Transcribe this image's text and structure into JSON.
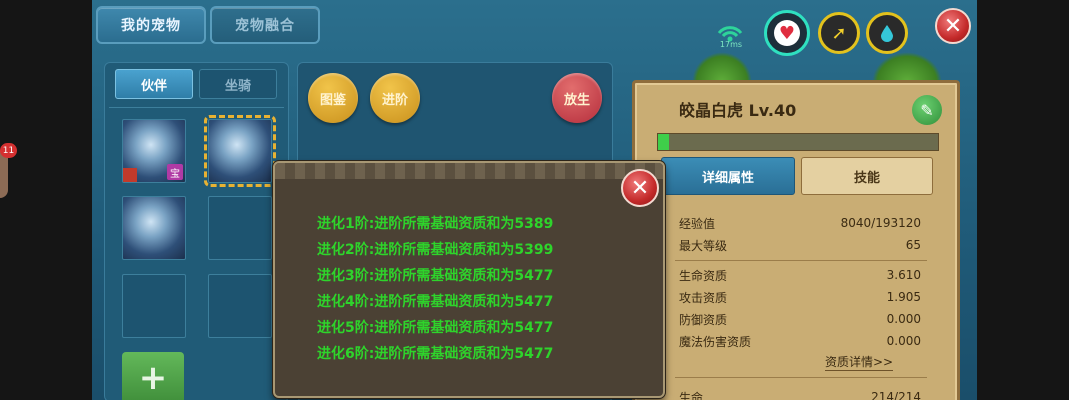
{
  "tabs": {
    "my_pets": "我的宠物",
    "pet_fusion": "宠物融合"
  },
  "status": {
    "ping": "17ms"
  },
  "left_notification_badge": "11",
  "pet_list": {
    "sub_tabs": [
      "伙伴",
      "坐骑"
    ],
    "pet_badge": "宝"
  },
  "mid_buttons": {
    "handbook": "图鉴",
    "advance": "进阶",
    "release": "放生"
  },
  "pet_info": {
    "name": "皎晶白虎 Lv.40",
    "tabs": [
      "详细属性",
      "技能"
    ],
    "exp_progress": 0.04,
    "rows": [
      {
        "label": "经验值",
        "value": "8040/193120"
      },
      {
        "label": "最大等级",
        "value": "65"
      }
    ],
    "aptitude_rows": [
      {
        "label": "生命资质",
        "value": "3.610"
      },
      {
        "label": "攻击资质",
        "value": "1.905"
      },
      {
        "label": "防御资质",
        "value": "0.000"
      },
      {
        "label": "魔法伤害资质",
        "value": "0.000"
      }
    ],
    "aptitude_link": "资质详情>>",
    "partial_row": {
      "label": "生命",
      "value": "214/214"
    }
  },
  "dialog": {
    "lines": [
      "进化1阶:进阶所需基础资质和为5389",
      "进化2阶:进阶所需基础资质和为5399",
      "进化3阶:进阶所需基础资质和为5477",
      "进化4阶:进阶所需基础资质和为5477",
      "进化5阶:进阶所需基础资质和为5477",
      "进化6阶:进阶所需基础资质和为5477"
    ]
  },
  "colors": {
    "dialog_text": "#2ed42b",
    "panel_blue": "#205b77",
    "info_panel": "#c9ad74"
  },
  "icons": [
    "wifi-icon",
    "heart-icon",
    "arm-icon",
    "water-drop-icon",
    "close-icon",
    "edit-icon",
    "plus-icon"
  ]
}
